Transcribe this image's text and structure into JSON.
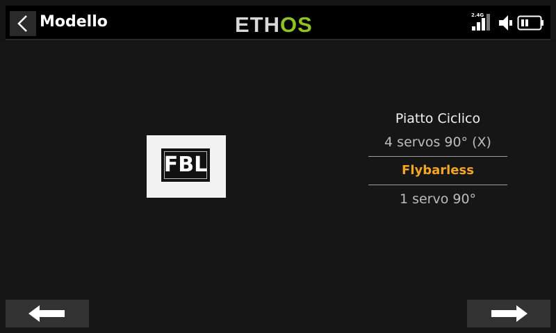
{
  "header": {
    "title": "Modello",
    "logo_left": "ETH",
    "logo_right": "OS",
    "signal_label": "2.4G",
    "icons": [
      "back-arrow-icon",
      "signal-bars-icon",
      "speaker-icon",
      "battery-icon"
    ]
  },
  "image": {
    "label": "FBL"
  },
  "list": {
    "heading": "Piatto Ciclico",
    "options": [
      {
        "label": "4 servos 90° (X)",
        "selected": false
      },
      {
        "label": "Flybarless",
        "selected": true
      },
      {
        "label": "1 servo 90°",
        "selected": false
      }
    ]
  },
  "footer": {
    "prev_icon": "arrow-left-icon",
    "next_icon": "arrow-right-icon"
  },
  "colors": {
    "accent": "#f5a623",
    "logo_green": "#8fc31f",
    "background": "#161616"
  }
}
